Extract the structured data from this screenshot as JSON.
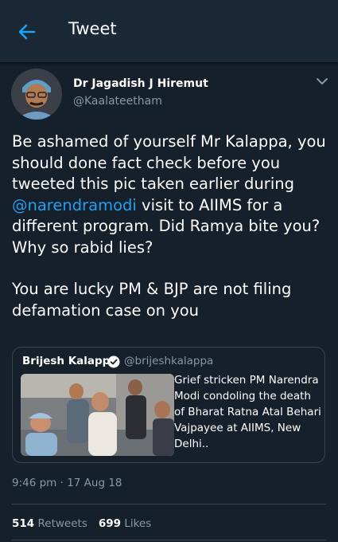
{
  "header": {
    "title": "Tweet"
  },
  "tweet": {
    "author_name": "Dr Jagadish J Hiremut",
    "author_handle": "@Kaalateetham",
    "text_1a": "Be ashamed of yourself Mr Kalappa, you should done fact check before you tweeted this pic taken earlier during ",
    "mention": "@narendramodi",
    "text_1b": " visit to AIIMS for a different program. Did Ramya bite you? Why so rabid lies?",
    "text_2": "You are lucky PM & BJP are not filing defamation case on you",
    "timestamp": "9:46 pm · 17 Aug 18"
  },
  "quoted": {
    "author_name": "Brijesh Kalappa",
    "author_handle": "@brijeshkalappa",
    "text": "Grief stricken PM Narendra Modi condoling the death of Bharat Ratna Atal Behari Vajpayee at AIIMS, New Delhi.."
  },
  "stats": {
    "retweets_count": "514",
    "retweets_label": "Retweets",
    "likes_count": "699",
    "likes_label": "Likes"
  },
  "colors": {
    "background": "#15202b",
    "header_bg": "#1b2836",
    "accent": "#1da1f2",
    "muted": "#8899a6",
    "border": "#38444d"
  },
  "icons": [
    "back-arrow-icon",
    "chevron-down-icon",
    "verified-badge-icon"
  ]
}
